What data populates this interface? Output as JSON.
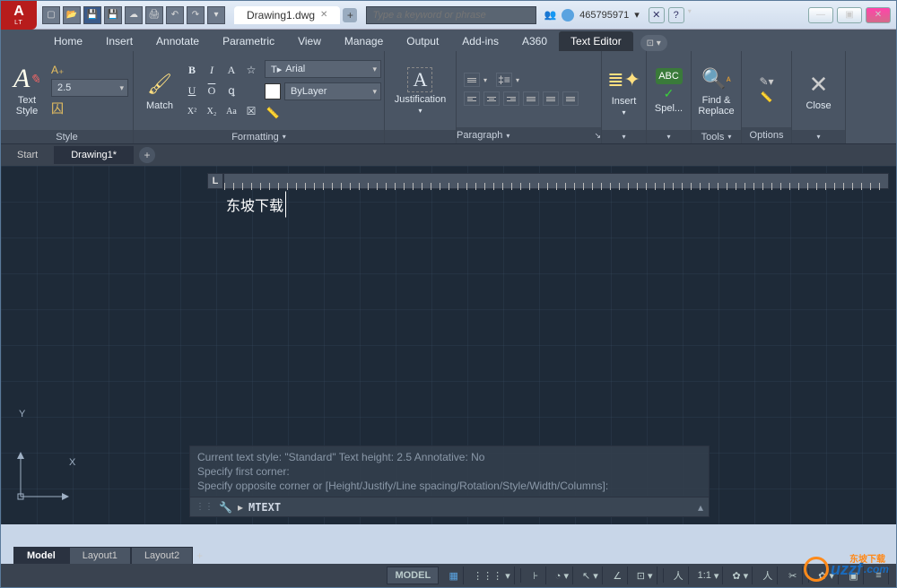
{
  "app": {
    "logo_text": "A",
    "logo_sub": "LT"
  },
  "doc": {
    "title": "Drawing1.dwg"
  },
  "search": {
    "placeholder": "Type a keyword or phrase"
  },
  "user": {
    "name": "465795971"
  },
  "qat": [
    "new",
    "open",
    "save",
    "saveas",
    "plot",
    "undo",
    "redo",
    "more"
  ],
  "menu": {
    "tabs": [
      "Home",
      "Insert",
      "Annotate",
      "Parametric",
      "View",
      "Manage",
      "Output",
      "Add-ins",
      "A360",
      "Text Editor"
    ],
    "active": "Text Editor"
  },
  "ribbon": {
    "style": {
      "label": "Style",
      "text_style": "Text Style",
      "height": "2.5",
      "annotative_icon": "※"
    },
    "formatting": {
      "label": "Formatting",
      "match": "Match",
      "font": "Arial",
      "layer": "ByLayer",
      "row1": [
        "B",
        "I",
        "A",
        "☆"
      ],
      "row2": [
        "U",
        "O",
        "ꝗ"
      ],
      "row3": [
        "X²",
        "X₂",
        "Aa",
        "☒"
      ]
    },
    "justification": {
      "label": "Justification",
      "btn": "Justification"
    },
    "paragraph": {
      "label": "Paragraph"
    },
    "insert": {
      "btn": "Insert"
    },
    "spell": {
      "btn": "Spel...",
      "abc": "ABC"
    },
    "find": {
      "btn": "Find & Replace"
    },
    "tools": {
      "label": "Tools"
    },
    "options": {
      "label": "Options"
    },
    "close": {
      "btn": "Close"
    }
  },
  "drawtabs": {
    "items": [
      "Start",
      "Drawing1*"
    ],
    "active": "Drawing1*"
  },
  "canvas": {
    "text": "东坡下载",
    "ucs_x": "X",
    "ucs_y": "Y",
    "ruler_L": "L"
  },
  "cmd": {
    "line1": "Current text style:  \"Standard\"  Text height:  2.5  Annotative:  No",
    "line2": "Specify first corner:",
    "line3": "Specify opposite corner or [Height/Justify/Line spacing/Rotation/Style/Width/Columns]:",
    "input": "MTEXT",
    "arrow": "▸"
  },
  "bottom": {
    "tabs": [
      "Model",
      "Layout1",
      "Layout2"
    ],
    "active": "Model"
  },
  "status": {
    "model": "MODEL",
    "scale": "1:1",
    "items": [
      "▦",
      "⋮⋮⋮",
      "⊦",
      "◔",
      "↖",
      "∠",
      "⊡",
      "人",
      "⊕",
      "人",
      "✂"
    ],
    "menu": "≡"
  },
  "watermark": {
    "text": "uzzf",
    "suffix": ".com",
    "cn": "东坡下载"
  }
}
